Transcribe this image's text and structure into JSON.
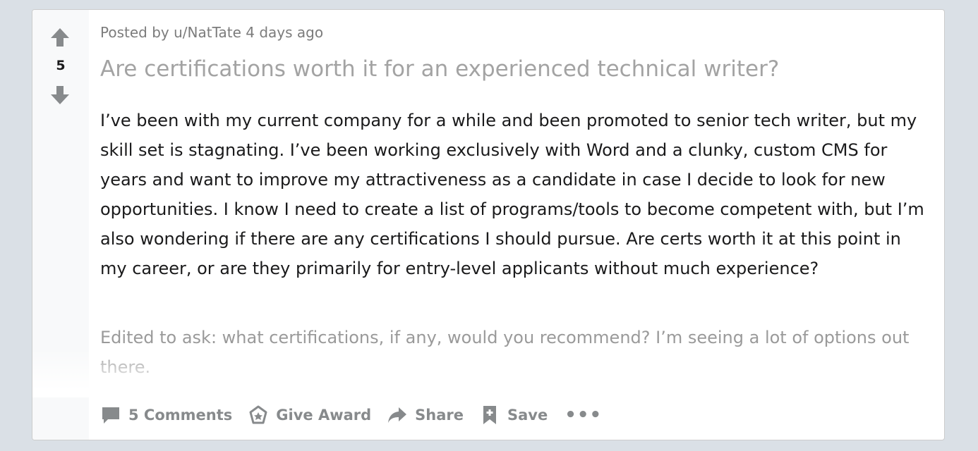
{
  "post": {
    "votes": "5",
    "meta": "Posted by u/NatTate 4 days ago",
    "title": "Are certifications worth it for an experienced technical writer?",
    "body": "I’ve been with my current company for a while and been promoted to senior tech writer, but my skill set is stagnating. I’ve been working exclusively with Word and a clunky, custom CMS for years and want to improve my attractiveness as a candidate in case I decide to look for new opportunities. I know I need to create a list of programs/tools to become competent with, but I’m also wondering if there are any certifications I should pursue. Are certs worth it at this point in my career, or are they primarily for entry-level applicants without much experience?",
    "edit": "Edited to ask: what certifications, if any, would you recommend? I’m seeing a lot of options out there."
  },
  "actions": {
    "comments_label": "5 Comments",
    "award_label": "Give Award",
    "share_label": "Share",
    "save_label": "Save",
    "more_label": "•••"
  },
  "icons": {
    "upvote": "arrow-up-icon",
    "downvote": "arrow-down-icon",
    "comments": "comment-bubble-icon",
    "award": "award-icon",
    "share": "share-arrow-icon",
    "save": "bookmark-icon"
  },
  "colors": {
    "icon_gray": "#878a8c",
    "background": "#dae0e6"
  }
}
